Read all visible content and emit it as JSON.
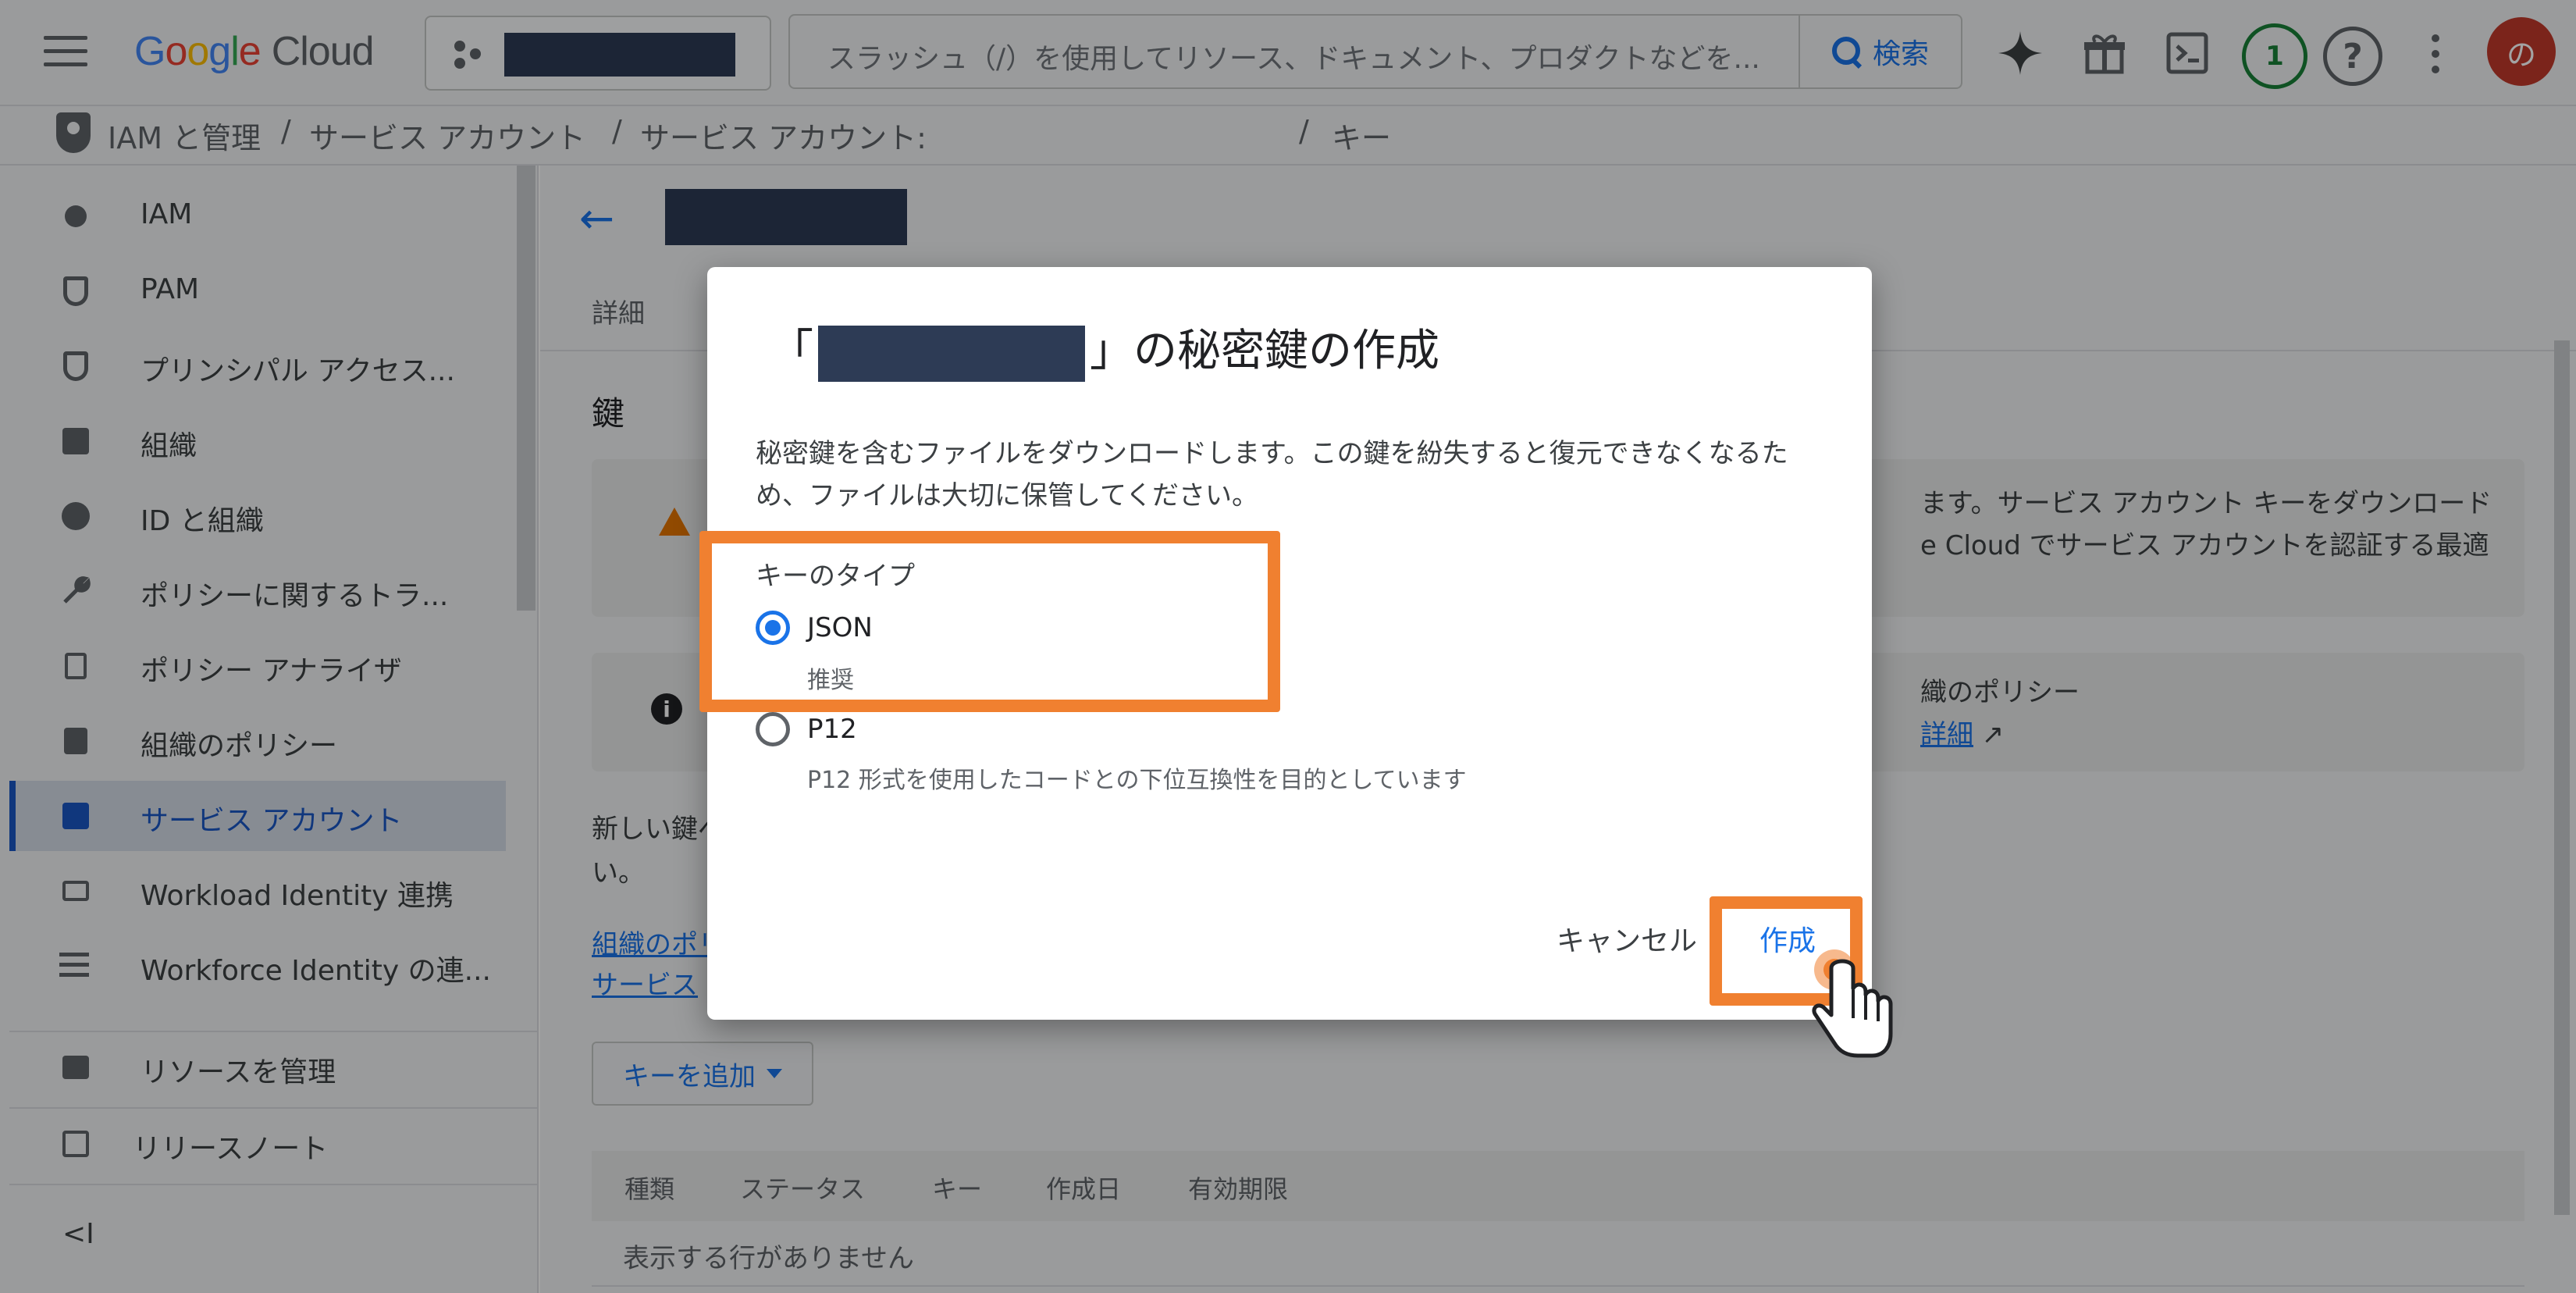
{
  "topbar": {
    "logo_google": [
      "G",
      "o",
      "o",
      "g",
      "l",
      "e"
    ],
    "logo_cloud": "Cloud",
    "search_placeholder": "スラッシュ（/）を使用してリソース、ドキュメント、プロダクトなどを...",
    "search_button": "検索",
    "notification_count": "1",
    "help": "?",
    "avatar_initial": "の"
  },
  "breadcrumb": {
    "items": [
      "IAM と管理",
      "/",
      "サービス アカウント",
      "/",
      "サービス アカウント:",
      "/",
      "キー"
    ]
  },
  "sidebar": {
    "items": [
      {
        "label": "IAM",
        "icon": "person-add-icon"
      },
      {
        "label": "PAM",
        "icon": "shield-icon"
      },
      {
        "label": "プリンシパル アクセス...",
        "icon": "shield-lock-icon"
      },
      {
        "label": "組織",
        "icon": "building-icon"
      },
      {
        "label": "ID と組織",
        "icon": "account-circle-icon"
      },
      {
        "label": "ポリシーに関するトラ...",
        "icon": "wrench-icon"
      },
      {
        "label": "ポリシー アナライザ",
        "icon": "policy-search-icon"
      },
      {
        "label": "組織のポリシー",
        "icon": "document-icon"
      },
      {
        "label": "サービス アカウント",
        "icon": "service-account-icon"
      },
      {
        "label": "Workload Identity 連携",
        "icon": "id-card-icon"
      },
      {
        "label": "Workforce Identity の連...",
        "icon": "list-icon"
      }
    ],
    "bottom_items": [
      {
        "label": "リソースを管理",
        "icon": "folder-gear-icon"
      },
      {
        "label": "リリースノート",
        "icon": "release-notes-icon"
      }
    ],
    "collapse": "<I"
  },
  "main": {
    "tab_details": "詳細",
    "section_title": "鍵",
    "warning_line1": "ます。サービス アカウント キーをダウンロード",
    "warning_line2": "e Cloud でサービス アカウントを認証する最適",
    "info_line1": "織のポリシー",
    "info_link": "詳細",
    "body_line1": "新しい鍵ペ",
    "body_line2": "い。",
    "link_line1": "組織のポリ",
    "link_line2": "サービス",
    "add_key_button": "キーを追加",
    "table_headers": [
      "種類",
      "ステータス",
      "キー",
      "作成日",
      "有効期限"
    ],
    "table_empty": "表示する行がありません"
  },
  "dialog": {
    "title_prefix": "「",
    "title_suffix": "」の秘密鍵の作成",
    "description": "秘密鍵を含むファイルをダウンロードします。この鍵を紛失すると復元できなくなるため、ファイルは大切に保管してください。",
    "key_type_label": "キーのタイプ",
    "option_json": "JSON",
    "option_json_sub": "推奨",
    "option_p12": "P12",
    "option_p12_sub": "P12 形式を使用したコードとの下位互換性を目的としています",
    "selected": "JSON",
    "cancel_button": "キャンセル",
    "create_button": "作成"
  },
  "colors": {
    "accent": "#1a73e8",
    "highlight": "#f08030",
    "redaction": "#2d3b55"
  }
}
